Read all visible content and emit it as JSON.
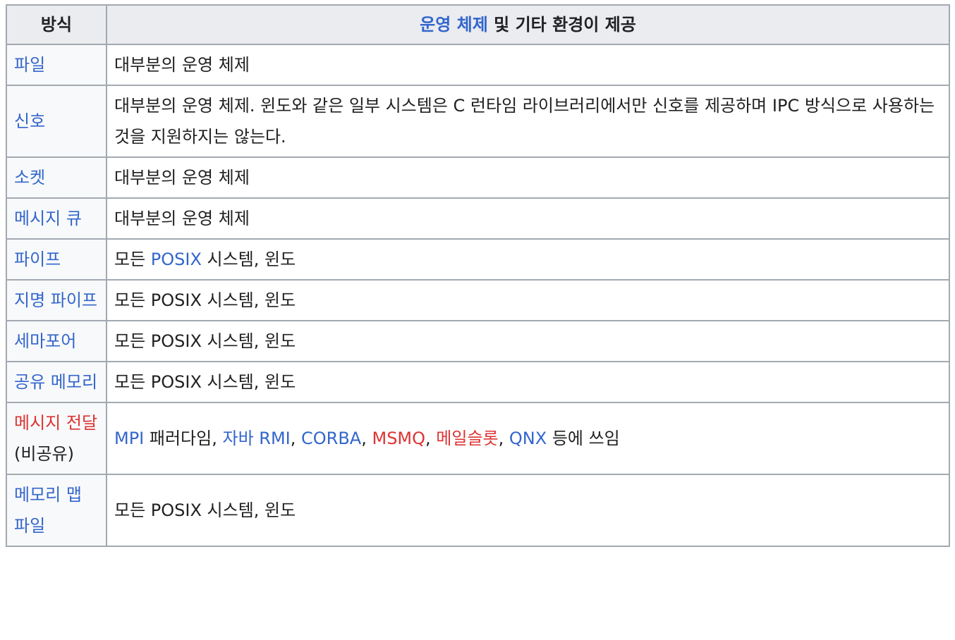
{
  "header": {
    "method": "방식",
    "support_link": "운영 체제",
    "support_rest": " 및 기타 환경이 제공"
  },
  "rows": [
    {
      "method": "파일",
      "support": "대부분의 운영 체제"
    },
    {
      "method": "신호",
      "support": "대부분의 운영 체제. 윈도와 같은 일부 시스템은 C 런타임 라이브러리에서만 신호를 제공하며 IPC 방식으로 사용하는 것을 지원하지는 않는다."
    },
    {
      "method": "소켓",
      "support": "대부분의 운영 체제"
    },
    {
      "method": "메시지 큐",
      "support": "대부분의 운영 체제"
    },
    {
      "method": "파이프",
      "support_parts": [
        "모든 ",
        "POSIX",
        " 시스템, 윈도"
      ]
    },
    {
      "method": "지명 파이프",
      "support": "모든 POSIX 시스템, 윈도"
    },
    {
      "method": "세마포어",
      "support": "모든 POSIX 시스템, 윈도"
    },
    {
      "method": "공유 메모리",
      "support": "모든 POSIX 시스템, 윈도"
    },
    {
      "method": "메시지 전달",
      "method_note": "(비공유)",
      "support_parts": [
        "MPI",
        " 패러다임, ",
        "자바 RMI",
        ", ",
        "CORBA",
        ", ",
        "MSMQ",
        ", ",
        "메일슬롯",
        ", ",
        "QNX",
        " 등에 쓰임"
      ]
    },
    {
      "method": "메모리 맵 파일",
      "support": "모든 POSIX 시스템, 윈도"
    }
  ],
  "colors": {
    "link": "#3366cc",
    "redlink": "#dd3333",
    "header_bg": "#eaecf0",
    "cell_bg": "#f8f9fa",
    "border": "#a2a9b1"
  }
}
